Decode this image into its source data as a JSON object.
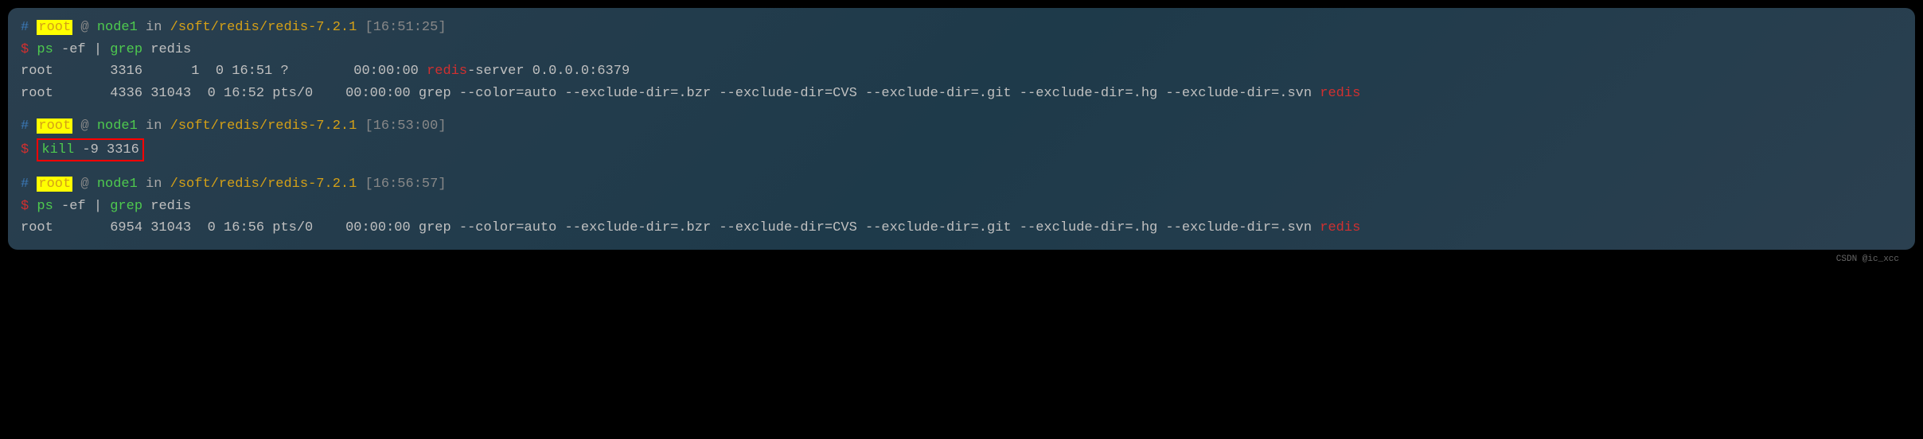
{
  "prompt1": {
    "hash": "#",
    "user": "root",
    "at": " @ ",
    "host": "node1",
    "in": " in ",
    "path": "/soft/redis/redis-7.2.1",
    "time": " [16:51:25]"
  },
  "cmd1": {
    "dollar": "$ ",
    "ps": "ps",
    "args": " -ef ",
    "pipe": "|",
    "grep": " grep",
    "grepargs": " redis"
  },
  "out1a": {
    "pre": "root       3316      1  0 16:51 ?        00:00:00 ",
    "redis": "redis",
    "post": "-server 0.0.0.0:6379"
  },
  "out1b": {
    "pre": "root       4336 31043  0 16:52 pts/0    00:00:00 grep --color=auto --exclude-dir=.bzr --exclude-dir=CVS --exclude-dir=.git --exclude-dir=.hg --exclude-dir=.svn ",
    "redis": "redis"
  },
  "prompt2": {
    "hash": "#",
    "user": "root",
    "at": " @ ",
    "host": "node1",
    "in": " in ",
    "path": "/soft/redis/redis-7.2.1",
    "time": " [16:53:00]"
  },
  "cmd2": {
    "dollar": "$ ",
    "kill": "kill",
    "args": " -9 3316"
  },
  "prompt3": {
    "hash": "#",
    "user": "root",
    "at": " @ ",
    "host": "node1",
    "in": " in ",
    "path": "/soft/redis/redis-7.2.1",
    "time": " [16:56:57]"
  },
  "cmd3": {
    "dollar": "$ ",
    "ps": "ps",
    "args": " -ef ",
    "pipe": "|",
    "grep": " grep",
    "grepargs": " redis"
  },
  "out3": {
    "pre": "root       6954 31043  0 16:56 pts/0    00:00:00 grep --color=auto --exclude-dir=.bzr --exclude-dir=CVS --exclude-dir=.git --exclude-dir=.hg --exclude-dir=.svn ",
    "redis": "redis"
  },
  "watermark": "CSDN @ic_xcc"
}
